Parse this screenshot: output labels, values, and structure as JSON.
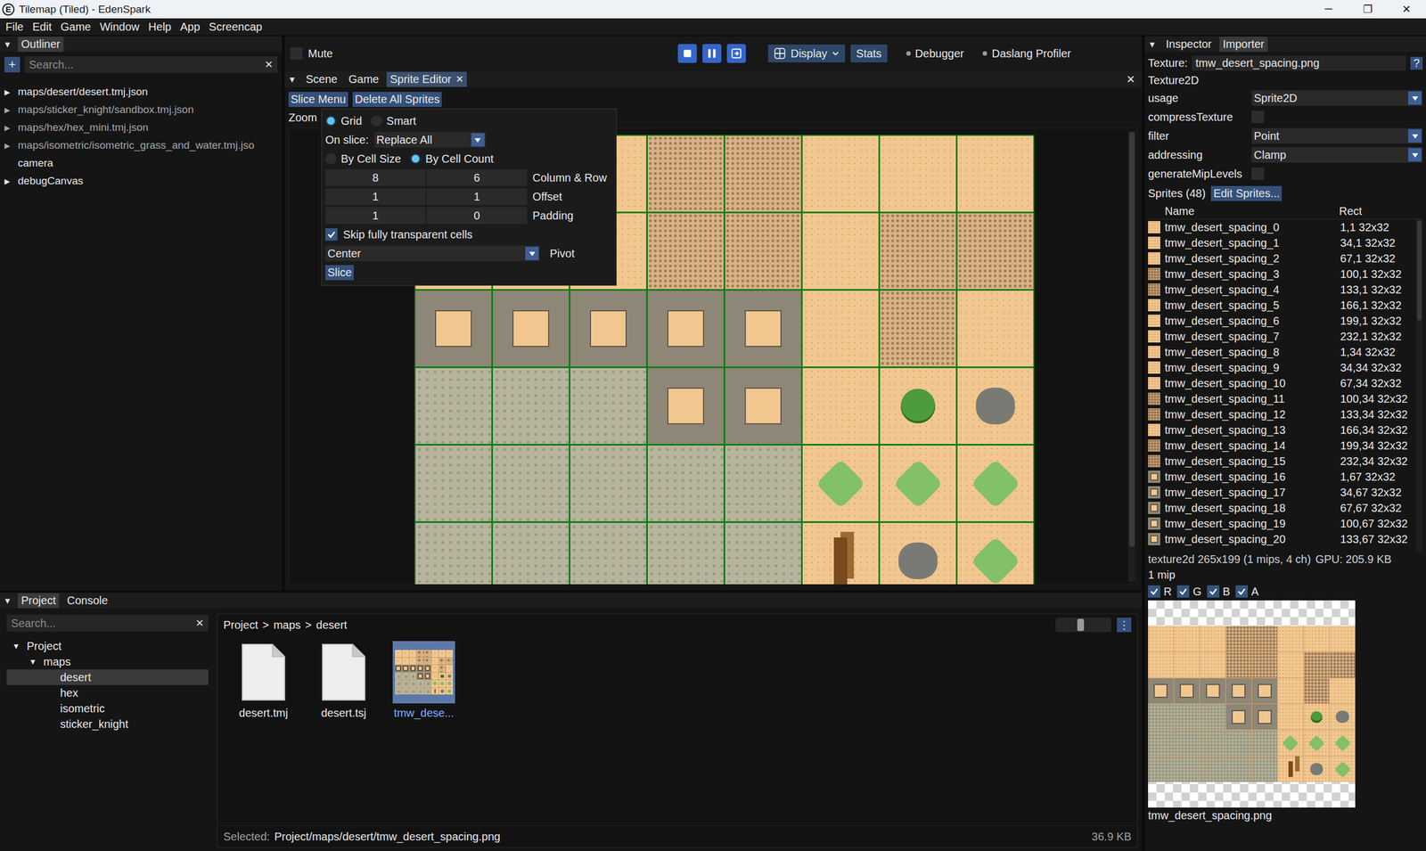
{
  "window": {
    "title": "Tilemap (Tiled) - EdenSpark",
    "logo": "E",
    "controls": [
      "─",
      "❐",
      "✕"
    ]
  },
  "menu": [
    "File",
    "Edit",
    "Game",
    "Window",
    "Help",
    "App",
    "Screencap"
  ],
  "outliner": {
    "collapse": "▼",
    "title": "Outliner",
    "add": "+",
    "search_placeholder": "Search...",
    "clear": "✕",
    "expand_icon": "▶",
    "items": [
      {
        "label": "maps/desert/desert.tmj.json",
        "expandable": true,
        "disabled": false
      },
      {
        "label": "maps/sticker_knight/sandbox.tmj.json",
        "expandable": true,
        "disabled": true
      },
      {
        "label": "maps/hex/hex_mini.tmj.json",
        "expandable": true,
        "disabled": true
      },
      {
        "label": "maps/isometric/isometric_grass_and_water.tmj.jso",
        "expandable": true,
        "disabled": true
      },
      {
        "label": "camera",
        "expandable": false,
        "disabled": false
      },
      {
        "label": "debugCanvas",
        "expandable": true,
        "disabled": false
      }
    ]
  },
  "toolbar": {
    "mute": {
      "label": "Mute",
      "checked": false
    },
    "display": "Display",
    "stats": "Stats",
    "debugger": "Debugger",
    "profiler": "Daslang Profiler"
  },
  "center": {
    "collapse": "▼",
    "close": "✕",
    "tabs": [
      {
        "label": "Scene",
        "selected": false,
        "closable": false
      },
      {
        "label": "Game",
        "selected": false,
        "closable": false
      },
      {
        "label": "Sprite Editor",
        "selected": true,
        "closable": true
      }
    ]
  },
  "sprite_editor": {
    "buttons": [
      "Slice Menu",
      "Delete All Sprites"
    ],
    "zoom_label": "Zoom"
  },
  "slice_popup": {
    "modes": [
      {
        "label": "Grid",
        "selected": true
      },
      {
        "label": "Smart",
        "selected": false
      }
    ],
    "on_slice_label": "On slice:",
    "on_slice_value": "Replace All",
    "methods": [
      {
        "label": "By Cell Size",
        "selected": false
      },
      {
        "label": "By Cell Count",
        "selected": true
      }
    ],
    "fields": [
      {
        "values": [
          "8",
          "6"
        ],
        "label": "Column & Row"
      },
      {
        "values": [
          "1",
          "1"
        ],
        "label": "Offset"
      },
      {
        "values": [
          "1",
          "0"
        ],
        "label": "Padding"
      }
    ],
    "skip_transparent": {
      "label": "Skip fully transparent cells",
      "checked": true
    },
    "pivot": {
      "value": "Center",
      "label": "Pivot"
    },
    "slice_button": "Slice"
  },
  "inspector": {
    "collapse": "▼",
    "tabs": [
      {
        "label": "Inspector",
        "selected": false
      },
      {
        "label": "Importer",
        "selected": true
      }
    ],
    "texture_label": "Texture:",
    "texture_value": "tmw_desert_spacing.png",
    "help": "?",
    "section": "Texture2D",
    "properties": [
      {
        "name": "usage",
        "kind": "dropdown",
        "value": "Sprite2D",
        "checked": false
      },
      {
        "name": "compressTexture",
        "kind": "checkbox",
        "value": "",
        "checked": false
      },
      {
        "name": "filter",
        "kind": "dropdown",
        "value": "Point",
        "checked": false
      },
      {
        "name": "addressing",
        "kind": "dropdown",
        "value": "Clamp",
        "checked": false
      },
      {
        "name": "generateMipLevels",
        "kind": "checkbox",
        "value": "",
        "checked": false
      }
    ],
    "sprites_label": "Sprites (48)",
    "edit_sprites": "Edit Sprites...",
    "columns": [
      "Name",
      "Rect"
    ],
    "sprites": [
      {
        "name": "tmw_desert_spacing_0",
        "rect": "1,1 32x32"
      },
      {
        "name": "tmw_desert_spacing_1",
        "rect": "34,1 32x32"
      },
      {
        "name": "tmw_desert_spacing_2",
        "rect": "67,1 32x32"
      },
      {
        "name": "tmw_desert_spacing_3",
        "rect": "100,1 32x32"
      },
      {
        "name": "tmw_desert_spacing_4",
        "rect": "133,1 32x32"
      },
      {
        "name": "tmw_desert_spacing_5",
        "rect": "166,1 32x32"
      },
      {
        "name": "tmw_desert_spacing_6",
        "rect": "199,1 32x32"
      },
      {
        "name": "tmw_desert_spacing_7",
        "rect": "232,1 32x32"
      },
      {
        "name": "tmw_desert_spacing_8",
        "rect": "1,34 32x32"
      },
      {
        "name": "tmw_desert_spacing_9",
        "rect": "34,34 32x32"
      },
      {
        "name": "tmw_desert_spacing_10",
        "rect": "67,34 32x32"
      },
      {
        "name": "tmw_desert_spacing_11",
        "rect": "100,34 32x32"
      },
      {
        "name": "tmw_desert_spacing_12",
        "rect": "133,34 32x32"
      },
      {
        "name": "tmw_desert_spacing_13",
        "rect": "166,34 32x32"
      },
      {
        "name": "tmw_desert_spacing_14",
        "rect": "199,34 32x32"
      },
      {
        "name": "tmw_desert_spacing_15",
        "rect": "232,34 32x32"
      },
      {
        "name": "tmw_desert_spacing_16",
        "rect": "1,67 32x32"
      },
      {
        "name": "tmw_desert_spacing_17",
        "rect": "34,67 32x32"
      },
      {
        "name": "tmw_desert_spacing_18",
        "rect": "67,67 32x32"
      },
      {
        "name": "tmw_desert_spacing_19",
        "rect": "100,67 32x32"
      },
      {
        "name": "tmw_desert_spacing_20",
        "rect": "133,67 32x32"
      }
    ],
    "info": "texture2d 265x199 (1 mips, 4 ch)",
    "gpu": "GPU: 205.9 KB",
    "mips": "1 mip",
    "channels": [
      {
        "label": "R",
        "checked": true
      },
      {
        "label": "G",
        "checked": true
      },
      {
        "label": "B",
        "checked": true
      },
      {
        "label": "A",
        "checked": true
      }
    ],
    "filename": "tmw_desert_spacing.png"
  },
  "project": {
    "collapse": "▼",
    "tabs": [
      {
        "label": "Project",
        "selected": true
      },
      {
        "label": "Console",
        "selected": false
      }
    ],
    "search_placeholder": "Search...",
    "clear": "✕",
    "expanded_icon": "▼",
    "tree": [
      {
        "label": "Project",
        "expanded": true,
        "selected": false,
        "children": [
          {
            "label": "maps",
            "expanded": true,
            "selected": false,
            "children": [
              {
                "label": "desert",
                "selected": true
              },
              {
                "label": "hex",
                "selected": false
              },
              {
                "label": "isometric",
                "selected": false
              },
              {
                "label": "sticker_knight",
                "selected": false
              }
            ]
          }
        ]
      }
    ],
    "breadcrumb": [
      "Project",
      "maps",
      "desert"
    ],
    "breadcrumb_separator": ">",
    "icon_size_slider": {
      "level": 0.45
    },
    "more": "⋮",
    "files": [
      {
        "name": "desert.tmj",
        "kind": "document",
        "selected": false
      },
      {
        "name": "desert.tsj",
        "kind": "document",
        "selected": false
      },
      {
        "name": "tmw_dese...",
        "kind": "image",
        "selected": true
      }
    ],
    "status": {
      "label": "Selected:",
      "path": "Project/maps/desert/tmw_desert_spacing.png",
      "size": "36.9 KB"
    }
  }
}
